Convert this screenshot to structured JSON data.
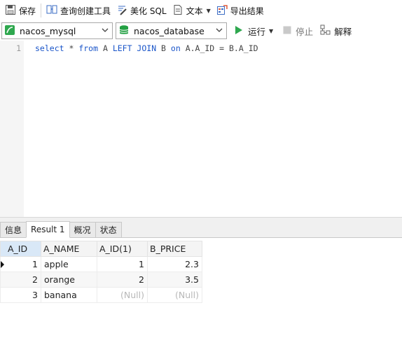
{
  "toolbar": {
    "save": "保存",
    "query_builder": "查询创建工具",
    "beautify": "美化 SQL",
    "text": "文本",
    "export": "导出结果"
  },
  "connection": {
    "selected": "nacos_mysql",
    "database": "nacos_database",
    "run": "运行",
    "stop": "停止",
    "explain": "解释"
  },
  "editor": {
    "line_number": "1",
    "tokens": [
      {
        "t": "select",
        "kw": true
      },
      {
        "t": " * ",
        "kw": false
      },
      {
        "t": "from",
        "kw": true
      },
      {
        "t": " A ",
        "kw": false
      },
      {
        "t": "LEFT JOIN",
        "kw": true
      },
      {
        "t": " B ",
        "kw": false
      },
      {
        "t": "on",
        "kw": true
      },
      {
        "t": " A.A_ID = B.A_ID",
        "kw": false
      }
    ]
  },
  "tabs": [
    "信息",
    "Result 1",
    "概况",
    "状态"
  ],
  "active_tab": 1,
  "grid": {
    "columns": [
      "A_ID",
      "A_NAME",
      "A_ID(1)",
      "B_PRICE"
    ],
    "rows": [
      [
        "1",
        "apple",
        "1",
        "2.3"
      ],
      [
        "2",
        "orange",
        "2",
        "3.5"
      ],
      [
        "3",
        "banana",
        "(Null)",
        "(Null)"
      ]
    ]
  },
  "colors": {
    "keyword": "#1a55c9",
    "run_green": "#2fa84f",
    "db_green": "#23a043",
    "null_gray": "#b8b8b8"
  }
}
